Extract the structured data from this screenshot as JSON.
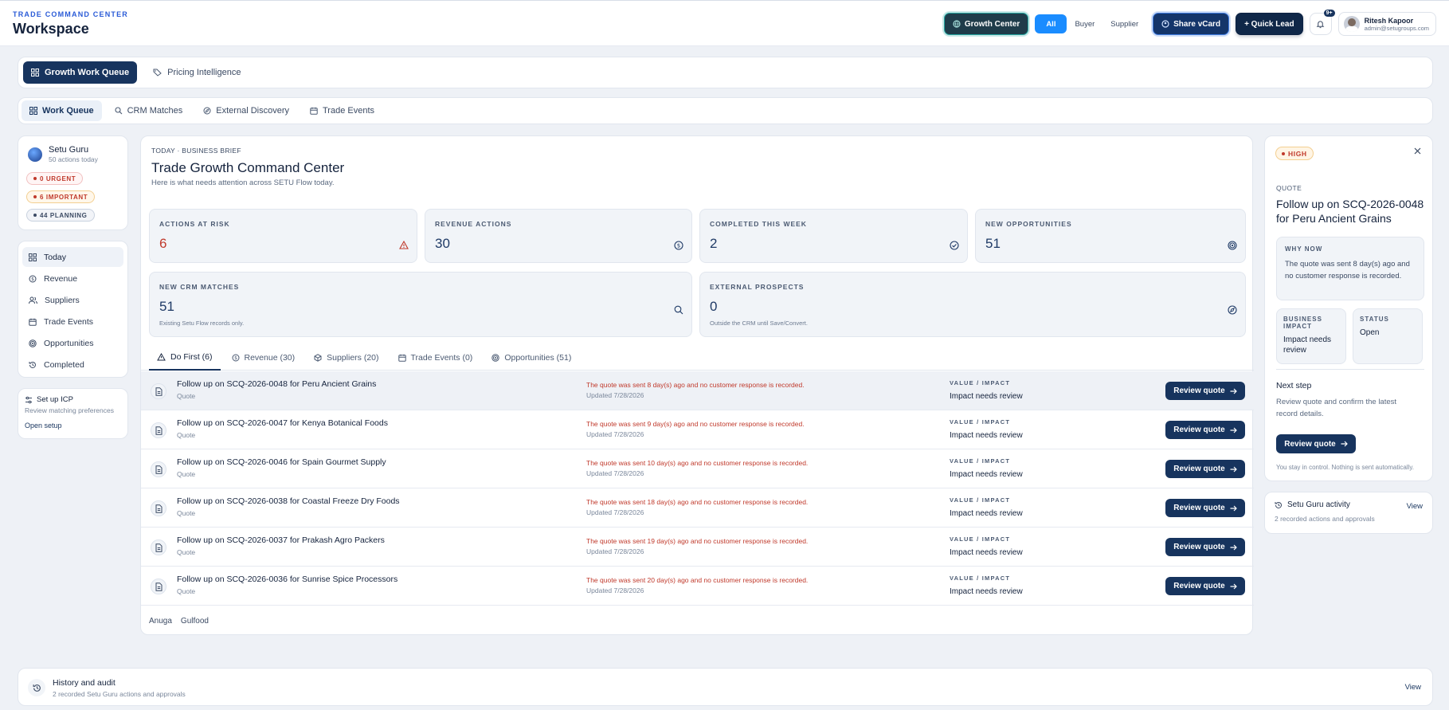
{
  "header": {
    "brand_sup": "TRADE COMMAND CENTER",
    "brand": "Workspace",
    "growth_center": "Growth Center",
    "segments": [
      "All",
      "Buyer",
      "Supplier"
    ],
    "share_vcard": "Share vCard",
    "quick_lead": "+ Quick Lead",
    "notif_badge": "9+",
    "user_name": "Ritesh Kapoor",
    "user_email": "admin@setugroups.com"
  },
  "tabs_primary": [
    {
      "label": "Growth Work Queue",
      "icon": "grid-icon",
      "active": true
    },
    {
      "label": "Pricing Intelligence",
      "icon": "tag-icon",
      "active": false
    }
  ],
  "tabs_secondary": [
    {
      "label": "Work Queue",
      "icon": "grid-icon",
      "active": true
    },
    {
      "label": "CRM Matches",
      "icon": "search-icon",
      "active": false
    },
    {
      "label": "External Discovery",
      "icon": "compass-icon",
      "active": false
    },
    {
      "label": "Trade Events",
      "icon": "calendar-icon",
      "active": false
    }
  ],
  "guru": {
    "name": "Setu Guru",
    "sub": "50 actions today",
    "pills": [
      "0 URGENT",
      "6 IMPORTANT",
      "44 PLANNING"
    ]
  },
  "left_nav": [
    {
      "label": "Today",
      "icon": "grid-icon",
      "active": true
    },
    {
      "label": "Revenue",
      "icon": "dollar-icon",
      "active": false
    },
    {
      "label": "Suppliers",
      "icon": "users-icon",
      "active": false
    },
    {
      "label": "Trade Events",
      "icon": "calendar-icon",
      "active": false
    },
    {
      "label": "Opportunities",
      "icon": "target-icon",
      "active": false
    },
    {
      "label": "Completed",
      "icon": "history-icon",
      "active": false
    }
  ],
  "icp": {
    "title": "Set up ICP",
    "sub": "Review matching preferences",
    "link": "Open setup"
  },
  "brief": {
    "sup": "TODAY · BUSINESS BRIEF",
    "title": "Trade Growth Command Center",
    "sub": "Here is what needs attention across SETU Flow today."
  },
  "kpis": [
    {
      "label": "ACTIONS AT RISK",
      "value": "6",
      "icon": "warning-icon",
      "red": true,
      "note": ""
    },
    {
      "label": "REVENUE ACTIONS",
      "value": "30",
      "icon": "dollar-icon",
      "red": false,
      "note": ""
    },
    {
      "label": "COMPLETED THIS WEEK",
      "value": "2",
      "icon": "check-circle-icon",
      "red": false,
      "note": ""
    },
    {
      "label": "NEW OPPORTUNITIES",
      "value": "51",
      "icon": "target-icon",
      "red": false,
      "note": ""
    },
    {
      "label": "NEW CRM MATCHES",
      "value": "51",
      "icon": "search-icon",
      "red": false,
      "note": "Existing Setu Flow records only."
    },
    {
      "label": "EXTERNAL PROSPECTS",
      "value": "0",
      "icon": "compass-icon",
      "red": false,
      "note": "Outside the CRM until Save/Convert."
    }
  ],
  "queue_tabs": [
    {
      "label": "Do First (6)",
      "icon": "warning-icon",
      "active": true
    },
    {
      "label": "Revenue (30)",
      "icon": "dollar-icon",
      "active": false
    },
    {
      "label": "Suppliers (20)",
      "icon": "box-icon",
      "active": false
    },
    {
      "label": "Trade Events (0)",
      "icon": "calendar-icon",
      "active": false
    },
    {
      "label": "Opportunities (51)",
      "icon": "target-icon",
      "active": false
    }
  ],
  "rows": [
    {
      "title": "Follow up on SCQ-2026-0048 for Peru Ancient Grains",
      "type": "Quote",
      "reason": "The quote was sent 8 day(s) ago and no customer response is recorded.",
      "updated": "Updated 7/28/2026",
      "value_label": "VALUE / IMPACT",
      "value": "Impact needs review",
      "button": "Review quote"
    },
    {
      "title": "Follow up on SCQ-2026-0047 for Kenya Botanical Foods",
      "type": "Quote",
      "reason": "The quote was sent 9 day(s) ago and no customer response is recorded.",
      "updated": "Updated 7/28/2026",
      "value_label": "VALUE / IMPACT",
      "value": "Impact needs review",
      "button": "Review quote"
    },
    {
      "title": "Follow up on SCQ-2026-0046 for Spain Gourmet Supply",
      "type": "Quote",
      "reason": "The quote was sent 10 day(s) ago and no customer response is recorded.",
      "updated": "Updated 7/28/2026",
      "value_label": "VALUE / IMPACT",
      "value": "Impact needs review",
      "button": "Review quote"
    },
    {
      "title": "Follow up on SCQ-2026-0038 for Coastal Freeze Dry Foods",
      "type": "Quote",
      "reason": "The quote was sent 18 day(s) ago and no customer response is recorded.",
      "updated": "Updated 7/28/2026",
      "value_label": "VALUE / IMPACT",
      "value": "Impact needs review",
      "button": "Review quote"
    },
    {
      "title": "Follow up on SCQ-2026-0037 for Prakash Agro Packers",
      "type": "Quote",
      "reason": "The quote was sent 19 day(s) ago and no customer response is recorded.",
      "updated": "Updated 7/28/2026",
      "value_label": "VALUE / IMPACT",
      "value": "Impact needs review",
      "button": "Review quote"
    },
    {
      "title": "Follow up on SCQ-2026-0036 for Sunrise Spice Processors",
      "type": "Quote",
      "reason": "The quote was sent 20 day(s) ago and no customer response is recorded.",
      "updated": "Updated 7/28/2026",
      "value_label": "VALUE / IMPACT",
      "value": "Impact needs review",
      "button": "Review quote"
    }
  ],
  "shows": [
    "Anuga",
    "Gulfood"
  ],
  "detail": {
    "priority": "HIGH",
    "sup": "QUOTE",
    "title": "Follow up on SCQ-2026-0048 for Peru Ancient Grains",
    "why_label": "WHY NOW",
    "why_text": "The quote was sent 8 day(s) ago and no customer response is recorded.",
    "impact_label": "BUSINESS IMPACT",
    "impact_value": "Impact needs review",
    "status_label": "STATUS",
    "status_value": "Open",
    "next_label": "Next step",
    "next_text": "Review quote and confirm the latest record details.",
    "button": "Review quote",
    "control_note": "You stay in control. Nothing is sent automatically."
  },
  "activity": {
    "title": "Setu Guru activity",
    "sub": "2 recorded actions and approvals",
    "view": "View"
  },
  "history": {
    "title": "History and audit",
    "sub": "2 recorded Setu Guru actions and approvals",
    "view": "View"
  },
  "colors": {
    "accent": "#17345e",
    "active_segment": "#1a8cff",
    "risk": "#c0392b",
    "teal": "#26a5a0"
  }
}
